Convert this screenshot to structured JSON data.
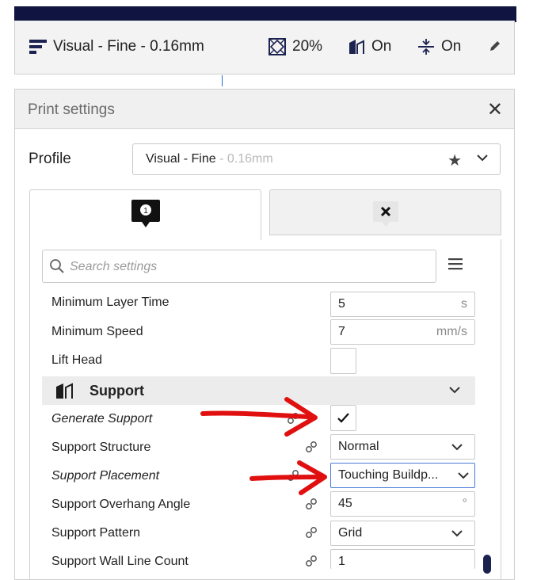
{
  "header": {
    "profile": "Visual - Fine - 0.16mm",
    "infill": "20%",
    "support": "On",
    "adhesion": "On",
    "icons": [
      "profile-lines-icon",
      "infill-icon",
      "support-icon",
      "adhesion-icon",
      "pencil-icon"
    ]
  },
  "panel": {
    "title": "Print settings",
    "profile_label": "Profile",
    "profile_name": "Visual - Fine",
    "profile_layer": " - 0.16mm",
    "tab1_badge": "1",
    "search_placeholder": "Search settings"
  },
  "settings": {
    "min_layer_time": {
      "label": "Minimum Layer Time",
      "value": "5",
      "unit": "s"
    },
    "min_speed": {
      "label": "Minimum Speed",
      "value": "7",
      "unit": "mm/s"
    },
    "lift_head": {
      "label": "Lift Head"
    },
    "support_section": "Support",
    "generate_support": {
      "label": "Generate Support",
      "checked": true
    },
    "support_structure": {
      "label": "Support Structure",
      "value": "Normal"
    },
    "support_placement": {
      "label": "Support Placement",
      "value": "Touching Buildp..."
    },
    "overhang_angle": {
      "label": "Support Overhang Angle",
      "value": "45",
      "unit": "°"
    },
    "support_pattern": {
      "label": "Support Pattern",
      "value": "Grid"
    },
    "wall_line_count": {
      "label": "Support Wall Line Count",
      "value": "1"
    }
  },
  "colors": {
    "accent_dark": "#0f1540",
    "arrow_red": "#e01010"
  }
}
